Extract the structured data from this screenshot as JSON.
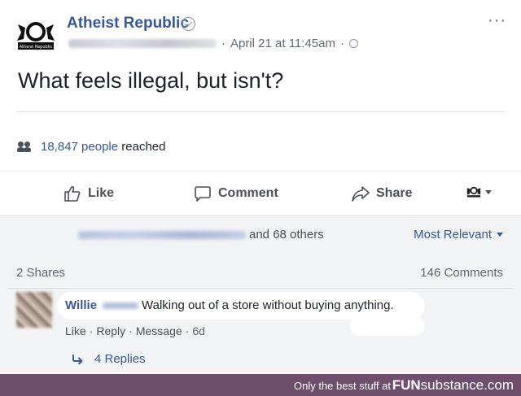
{
  "post": {
    "page_name": "Atheist Republic",
    "timestamp": "April 21 at 11:45am",
    "meta_sep_1": "·",
    "meta_sep_2": "·",
    "more": "···",
    "text": "What feels illegal, but isn't?",
    "reach_count": "18,847 people",
    "reach_suffix": "reached",
    "logo_text": "Atheist Republic"
  },
  "actions": {
    "like": "Like",
    "comment": "Comment",
    "share": "Share"
  },
  "engagement": {
    "others": "and 68 others",
    "sort": "Most Relevant",
    "shares": "2 Shares",
    "comments_count": "146 Comments"
  },
  "comment": {
    "author": "Willie",
    "text": "Walking out of a store without buying anything.",
    "like": "Like",
    "reply": "Reply",
    "message": "Message",
    "age": "6d",
    "sep": "·",
    "replies": "4 Replies"
  },
  "footer": {
    "tagline": "Only the best stuff at",
    "brand_a": "FUN",
    "brand_b": "substance.com"
  },
  "colors": {
    "link_blue": "#365899",
    "footer_purple": "#6e4e6d",
    "comments_bg": "#f2f3f5"
  }
}
